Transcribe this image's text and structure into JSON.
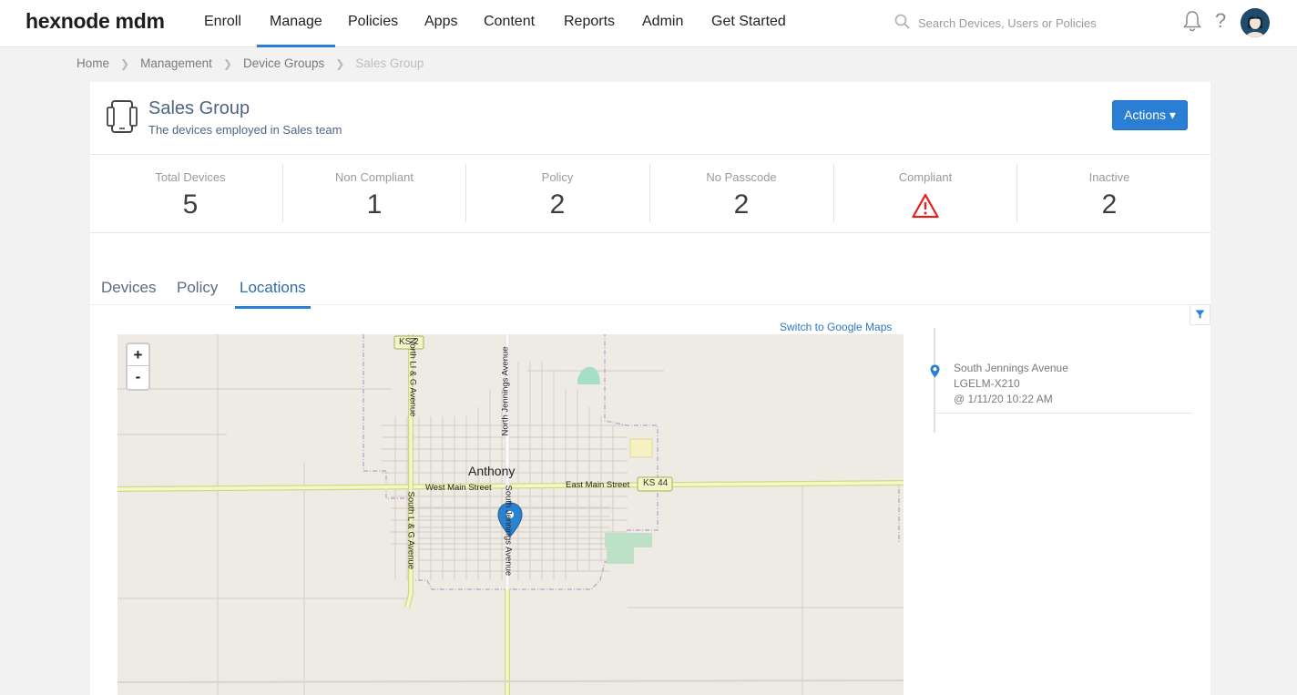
{
  "app": {
    "logo": "hexnode mdm"
  },
  "nav": {
    "items": [
      {
        "label": "Enroll"
      },
      {
        "label": "Manage"
      },
      {
        "label": "Policies"
      },
      {
        "label": "Apps"
      },
      {
        "label": "Content"
      },
      {
        "label": "Reports"
      },
      {
        "label": "Admin"
      },
      {
        "label": "Get Started"
      }
    ],
    "active": "Manage",
    "search_placeholder": "Search Devices, Users or Policies",
    "icons": [
      "search-icon",
      "bell-icon",
      "help-icon",
      "avatar"
    ]
  },
  "breadcrumb": {
    "items": [
      "Home",
      "Management",
      "Device Groups",
      "Sales Group"
    ]
  },
  "group": {
    "title": "Sales Group",
    "description": "The devices employed in Sales team",
    "actions_label": "Actions ▾"
  },
  "stats": [
    {
      "label": "Total Devices",
      "value": "5"
    },
    {
      "label": "Non Compliant",
      "value": "1"
    },
    {
      "label": "Policy",
      "value": "2"
    },
    {
      "label": "No Passcode",
      "value": "2"
    },
    {
      "label": "Compliant",
      "value": ""
    },
    {
      "label": "Inactive",
      "value": "2"
    }
  ],
  "tabs": {
    "items": [
      "Devices",
      "Policy",
      "Locations"
    ],
    "active": "Locations"
  },
  "map": {
    "switch_link": "Switch to Google Maps",
    "zoom_in": "+",
    "zoom_out": "-",
    "labels": {
      "town": "Anthony",
      "ks2": "KS 2",
      "ks44": "KS 44",
      "west_main": "West Main Street",
      "east_main": "East Main Street",
      "north_lg": "North LI & G Avenue",
      "south_lg": "South L & G Avenue",
      "north_jennings": "North Jennings Avenue",
      "south_jennings": "South Jennings Avenue"
    }
  },
  "locations": [
    {
      "address": "South Jennings Avenue",
      "device": "LGELM-X210",
      "time": "@ 1/11/20 10:22 AM"
    }
  ],
  "colors": {
    "accent": "#2a7fd4",
    "title_text": "#4c6585",
    "warning": "#e02020"
  }
}
